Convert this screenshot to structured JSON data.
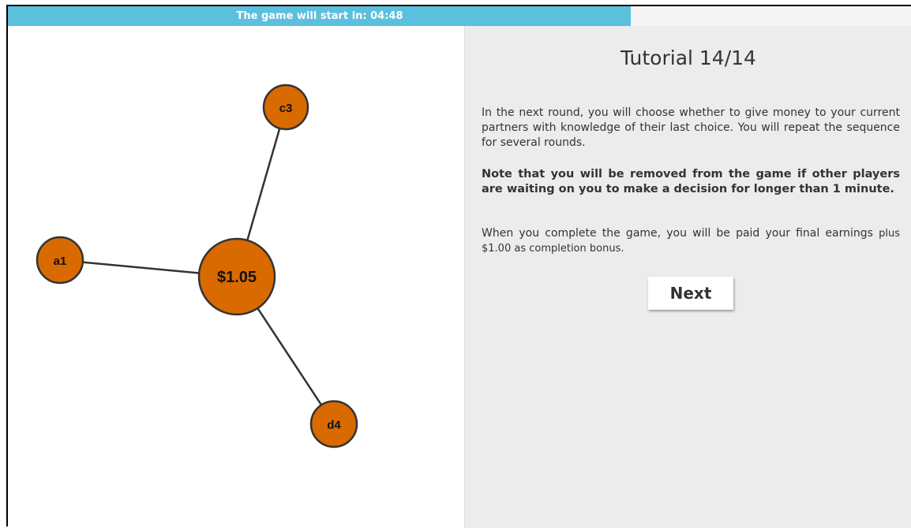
{
  "timer": {
    "text": "The game will start in: 04:48",
    "progress_fraction": 0.69,
    "color": "#5bc0de"
  },
  "graph": {
    "node_color": "#d96a00",
    "center": {
      "label": "$1.05"
    },
    "neighbors": [
      {
        "label": "c3"
      },
      {
        "label": "a1"
      },
      {
        "label": "d4"
      }
    ]
  },
  "tutorial": {
    "title": "Tutorial 14/14",
    "paragraph1": "In the next round, you will choose whether to give money to your current partners with knowledge of their last choice. You will repeat the sequence for several rounds.",
    "paragraph2": "Note that you will be removed from the game if other players are waiting on you to make a decision for longer than 1 minute.",
    "paragraph3_main": "When you complete the game, you will be paid your final earnings",
    "paragraph3_small": "plus $1.00 as completion bonus.",
    "next_label": "Next"
  }
}
